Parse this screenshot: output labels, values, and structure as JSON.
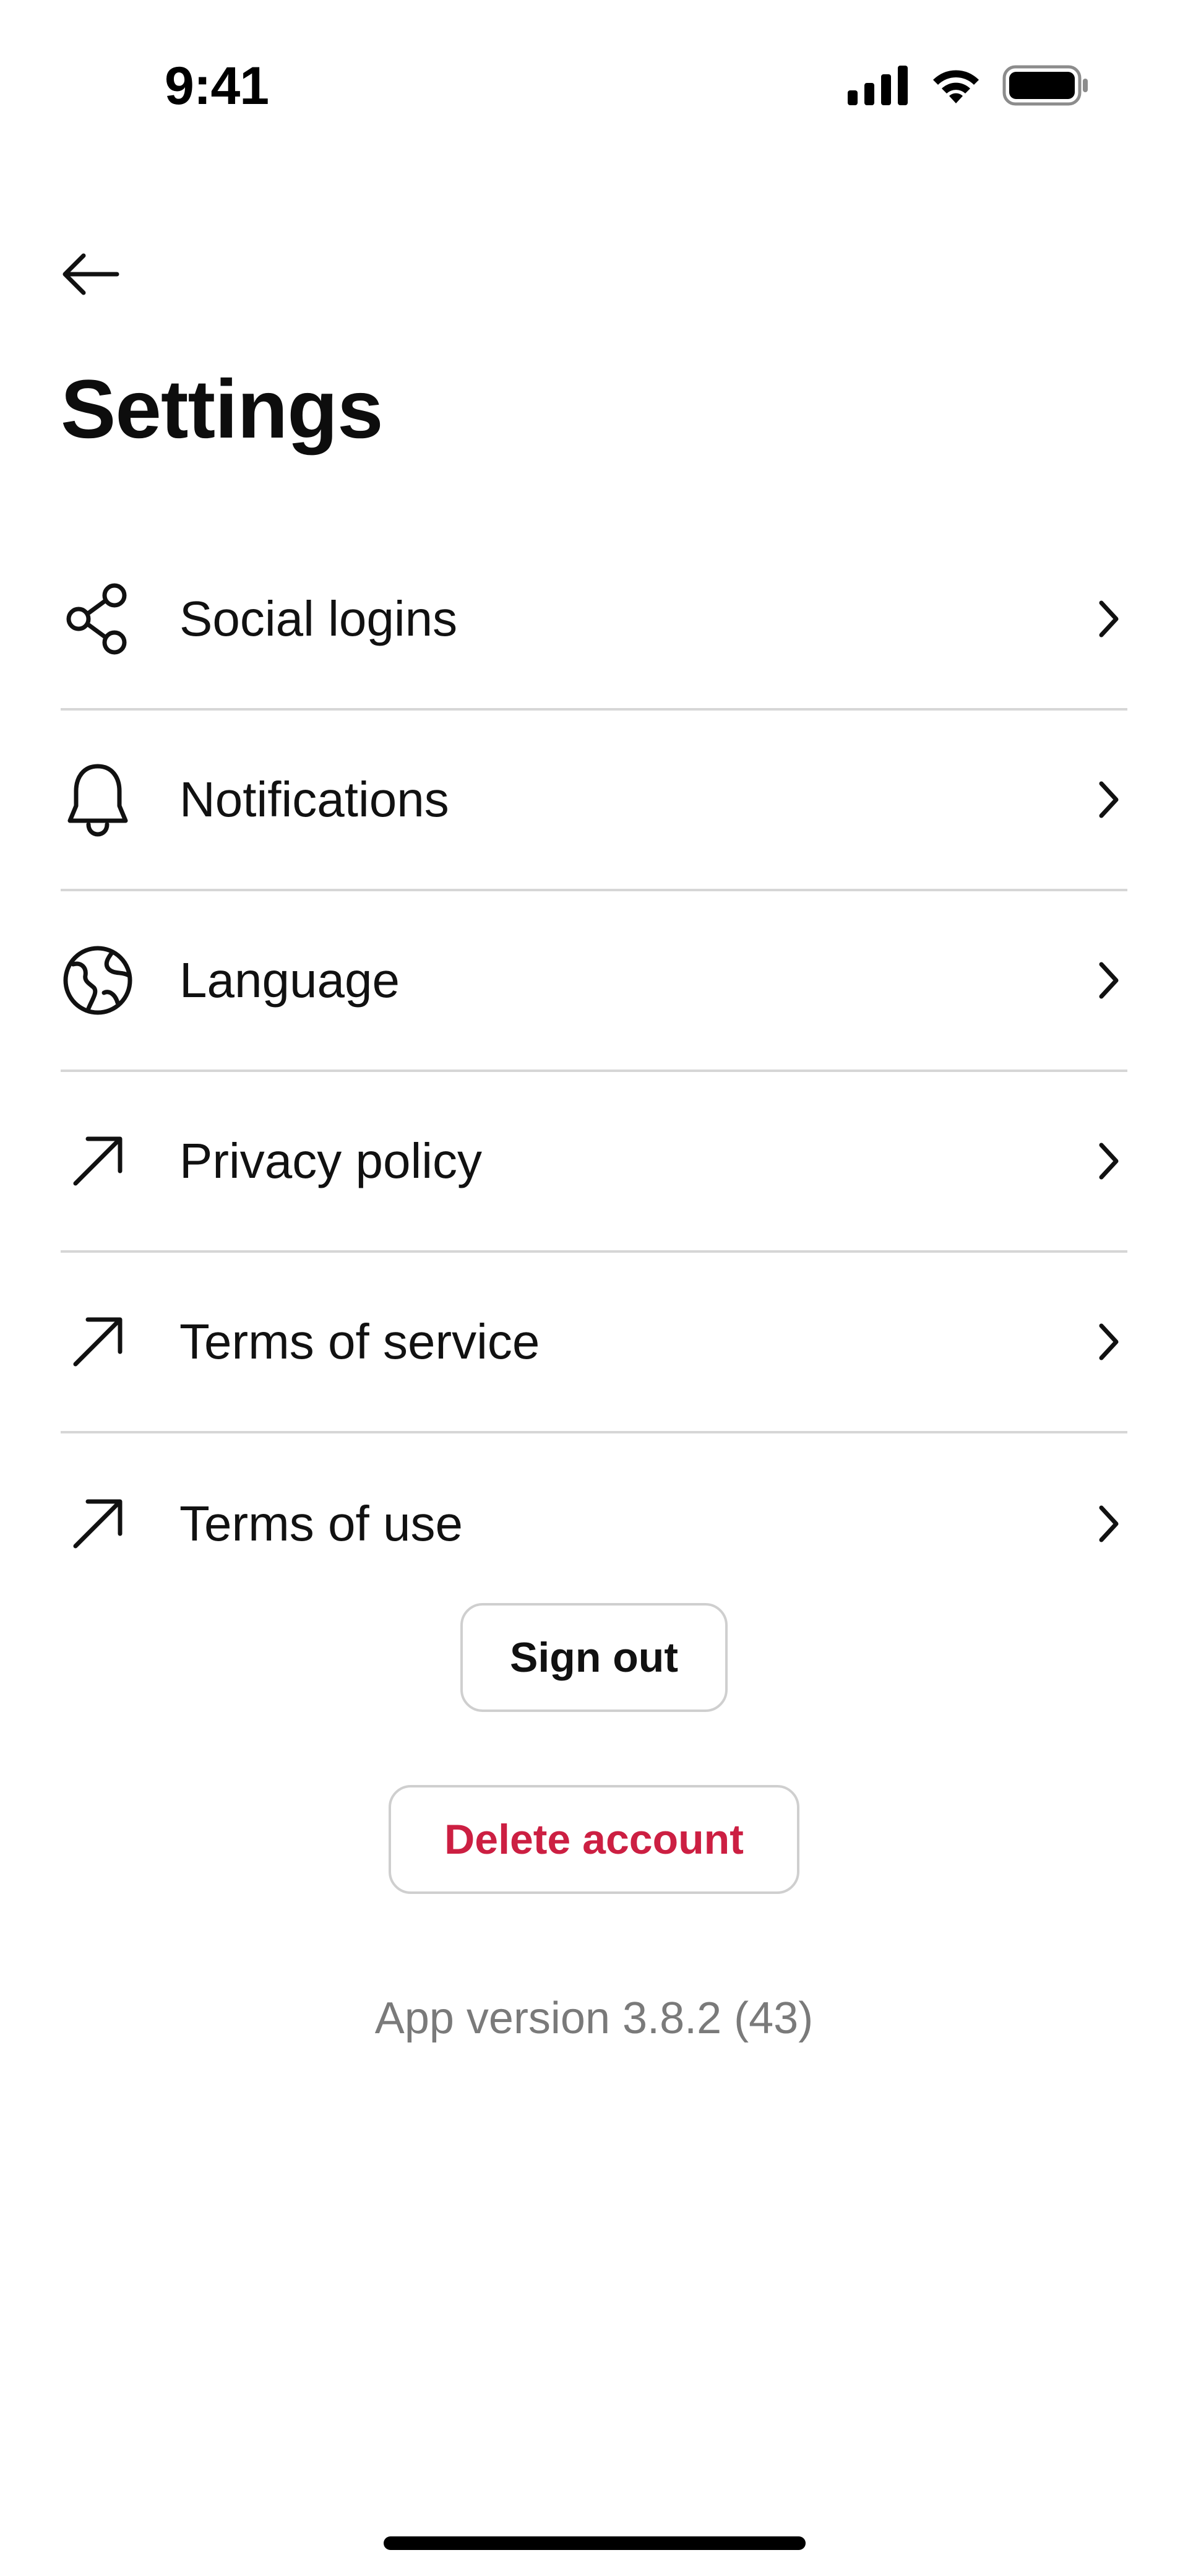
{
  "status_bar": {
    "time": "9:41"
  },
  "header": {
    "title": "Settings"
  },
  "settings_items": [
    {
      "label": "Social logins",
      "icon": "share-icon"
    },
    {
      "label": "Notifications",
      "icon": "bell-icon"
    },
    {
      "label": "Language",
      "icon": "globe-icon"
    },
    {
      "label": "Privacy policy",
      "icon": "external-link-arrow-icon"
    },
    {
      "label": "Terms of service",
      "icon": "external-link-arrow-icon"
    },
    {
      "label": "Terms of use",
      "icon": "external-link-arrow-icon"
    }
  ],
  "actions": {
    "sign_out_label": "Sign out",
    "delete_account_label": "Delete account"
  },
  "footer": {
    "app_version": "App version 3.8.2 (43)"
  },
  "colors": {
    "danger": "#cc1f42",
    "divider": "#d6d6d6",
    "muted_text": "#7a7a7a"
  }
}
